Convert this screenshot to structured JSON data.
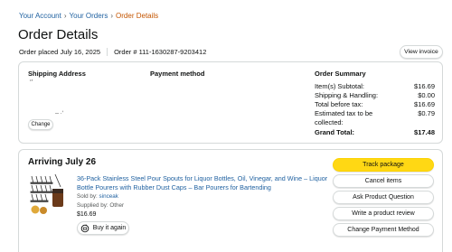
{
  "breadcrumb": {
    "items": [
      "Your Account",
      "Your Orders",
      "Order Details"
    ],
    "separator": "›"
  },
  "page": {
    "title": "Order Details",
    "order_placed": "Order placed July 16, 2025",
    "order_number": "Order # 111-1630287-9203412",
    "view_invoice_label": "View invoice"
  },
  "summary": {
    "shipping_address_heading": "Shipping Address",
    "address_fragment_1": "‘’",
    "address_fragment_2": "‐‐ ·‘",
    "change_label": "Change",
    "payment_method_heading": "Payment method",
    "order_summary_heading": "Order Summary",
    "rows": [
      {
        "label": "Item(s) Subtotal:",
        "value": "$16.69"
      },
      {
        "label": "Shipping & Handling:",
        "value": "$0.00"
      },
      {
        "label": "Total before tax:",
        "value": "$16.69"
      },
      {
        "label": "Estimated tax to be",
        "value": "$0.79"
      },
      {
        "label": "collected:",
        "value": ""
      }
    ],
    "grand_total_label": "Grand Total:",
    "grand_total_value": "$17.48"
  },
  "shipment": {
    "arriving": "Arriving July 26",
    "product_title": "36-Pack Stainless Steel Pour Spouts for Liquor Bottles, Oil, Vinegar, and Wine – Liquor Bottle Pourers with Rubber Dust Caps – Bar Pourers for Bartending",
    "sold_by_label": "Sold by:",
    "sold_by_name": "sinceak",
    "supplied_by": "Supplied by: Other",
    "price": "$16.69",
    "buy_again_label": "Buy it again",
    "actions": [
      "Track package",
      "Cancel items",
      "Ask Product Question",
      "Write a product review",
      "Change Payment Method"
    ]
  },
  "colors": {
    "link": "#2162a1",
    "current_crumb": "#c45500",
    "primary_button": "#ffd814",
    "border": "#d5d9d9"
  },
  "icons": {
    "buy_again": "refresh-cart-icon",
    "product_image": "pour-spouts-product-image"
  }
}
